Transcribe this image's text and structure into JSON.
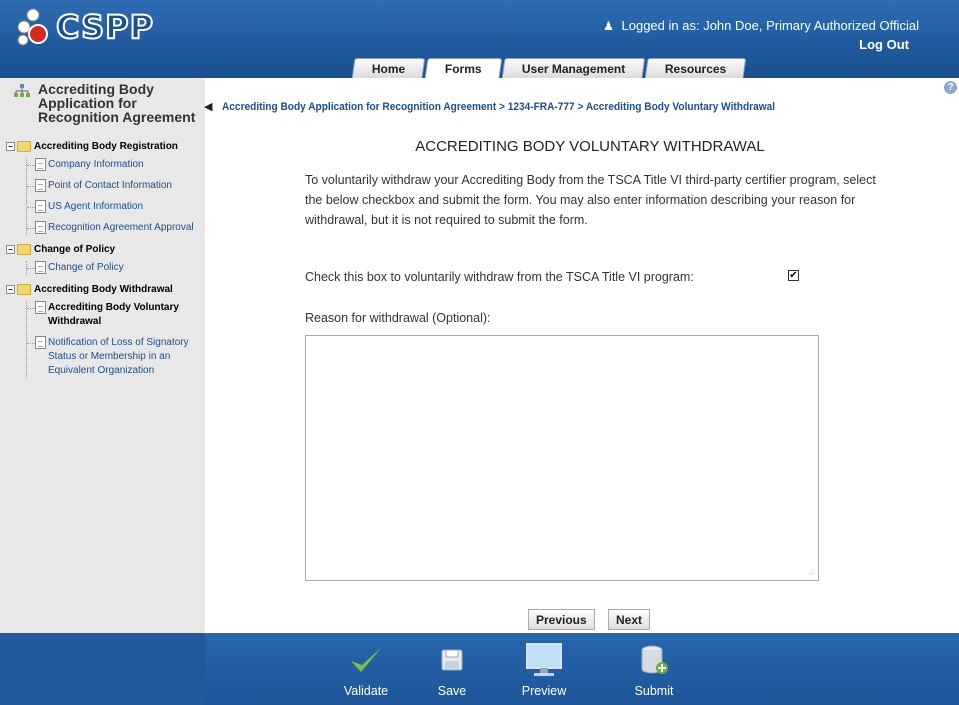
{
  "header": {
    "app_name": "CSPP",
    "logged_in_text": "Logged in as: John Doe, Primary Authorized Official",
    "logout_label": "Log Out",
    "tabs": [
      {
        "label": "Home",
        "active": false
      },
      {
        "label": "Forms",
        "active": true
      },
      {
        "label": "User Management",
        "active": false
      },
      {
        "label": "Resources",
        "active": false
      }
    ]
  },
  "sidebar": {
    "title": "Accrediting Body Application for Recognition Agreement",
    "groups": [
      {
        "label": "Accrediting Body Registration",
        "items": [
          {
            "label": "Company Information"
          },
          {
            "label": "Point of Contact Information"
          },
          {
            "label": "US Agent Information"
          },
          {
            "label": "Recognition Agreement Approval"
          }
        ]
      },
      {
        "label": "Change of Policy",
        "items": [
          {
            "label": "Change of Policy"
          }
        ]
      },
      {
        "label": "Accrediting Body Withdrawal",
        "items": [
          {
            "label": "Accrediting Body Voluntary Withdrawal",
            "current": true
          },
          {
            "label": "Notification of Loss of Signatory Status or Membership in an Equivalent Organization"
          }
        ]
      }
    ]
  },
  "main": {
    "breadcrumb": "Accrediting Body Application for Recognition Agreement > 1234-FRA-777 > Accrediting Body Voluntary Withdrawal",
    "title": "ACCREDITING BODY VOLUNTARY WITHDRAWAL",
    "intro": "To voluntarily withdraw your Accrediting Body from the TSCA Title VI third-party certifier program, select the below checkbox and submit the form. You may also enter information describing your reason for withdrawal, but it is not required to submit the form.",
    "checkbox_label": "Check this box to voluntarily withdraw from the TSCA Title VI program:",
    "checkbox_checked": true,
    "reason_label": "Reason for withdrawal (Optional):",
    "reason_value": "",
    "previous_label": "Previous",
    "next_label": "Next"
  },
  "footer": {
    "validate_label": "Validate",
    "save_label": "Save",
    "preview_label": "Preview",
    "submit_label": "Submit"
  },
  "colors": {
    "header_blue": "#1f5a9d",
    "link_blue": "#1a4f91",
    "validate_green": "#7cc242"
  }
}
